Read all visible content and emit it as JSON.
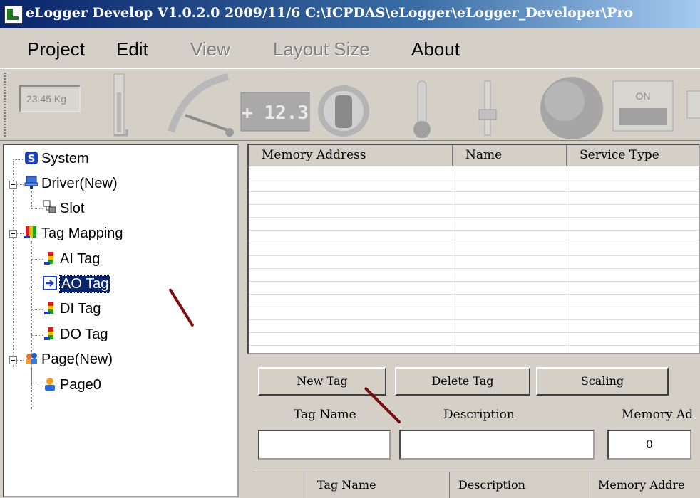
{
  "window": {
    "title": "eLogger Develop V1.0.2.0  2009/11/6  C:\\ICPDAS\\eLogger\\eLogger_Developer\\Pro"
  },
  "menu": {
    "items": [
      {
        "label": "Project",
        "enabled": true
      },
      {
        "label": "Edit",
        "enabled": true
      },
      {
        "label": "View",
        "enabled": false
      },
      {
        "label": "Layout Size",
        "enabled": false
      },
      {
        "label": "About",
        "enabled": true
      }
    ]
  },
  "toolbar": {
    "weight_display": "23.45 Kg",
    "digital_display": "+ 12.3",
    "switch_label": "ON",
    "tools": [
      "meter-display-icon",
      "vertical-bar-icon",
      "gauge-icon",
      "digital-display-icon",
      "traffic-light-icon",
      "thermometer-icon",
      "slider-icon",
      "round-led-icon",
      "switch-icon",
      "textbox-icon"
    ]
  },
  "tree": {
    "nodes": [
      {
        "label": "System",
        "icon": "system-icon"
      },
      {
        "label": "Driver(New)",
        "icon": "driver-icon"
      },
      {
        "label": "Slot",
        "icon": "slot-icon"
      },
      {
        "label": "Tag Mapping",
        "icon": "tag-mapping-icon"
      },
      {
        "label": "AI Tag",
        "icon": "tag-icon"
      },
      {
        "label": "AO Tag",
        "icon": "arrow-right-icon",
        "selected": true
      },
      {
        "label": "DI Tag",
        "icon": "tag-icon"
      },
      {
        "label": "DO Tag",
        "icon": "tag-icon"
      },
      {
        "label": "Page(New)",
        "icon": "page-group-icon"
      },
      {
        "label": "Page0",
        "icon": "page-icon"
      }
    ]
  },
  "tag_grid": {
    "columns": [
      "Memory Address",
      "Name",
      "Service Type"
    ]
  },
  "editor": {
    "new_tag": "New Tag",
    "delete_tag": "Delete Tag",
    "scaling": "Scaling",
    "tag_name_label": "Tag Name",
    "description_label": "Description",
    "memory_address_label": "Memory Ad",
    "tag_name_value": "",
    "description_value": "",
    "memory_address_value": "0"
  },
  "bottom_grid": {
    "columns": [
      "Tag Name",
      "Description",
      "Memory Addre"
    ]
  }
}
